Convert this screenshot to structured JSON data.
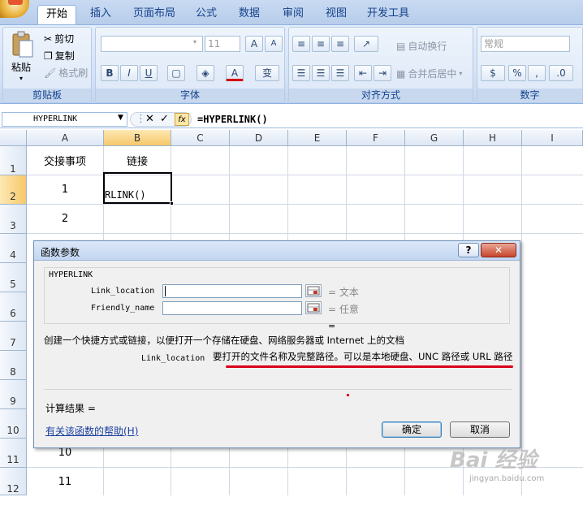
{
  "ribbon": {
    "tabs": [
      "开始",
      "插入",
      "页面布局",
      "公式",
      "数据",
      "审阅",
      "视图",
      "开发工具"
    ],
    "clipboard": {
      "paste": "粘贴",
      "cut": "剪切",
      "copy": "复制",
      "format_painter": "格式刷",
      "label": "剪贴板"
    },
    "font": {
      "size": "11",
      "bold": "B",
      "italic": "I",
      "underline": "U",
      "label": "字体",
      "grow": "A",
      "shrink": "A",
      "color": "A",
      "phonetic": "变"
    },
    "alignment": {
      "wrap": "自动换行",
      "merge": "合并后居中",
      "label": "对齐方式"
    },
    "number": {
      "format": "常规",
      "percent": "%",
      "comma": ",",
      "label": "数字",
      "currency": "$"
    }
  },
  "formula_bar": {
    "name_box": "HYPERLINK",
    "fx": "fx",
    "formula": "=HYPERLINK()"
  },
  "sheet": {
    "columns": [
      "A",
      "B",
      "C",
      "D",
      "E",
      "F",
      "G",
      "H",
      "I"
    ],
    "rows": [
      "1",
      "2",
      "3",
      "4",
      "5",
      "6",
      "7",
      "8",
      "9",
      "10",
      "11",
      "12"
    ],
    "a1": "交接事项",
    "b1": "链接",
    "a2": "1",
    "a3": "2",
    "a11": "10",
    "a12": "11",
    "b2": "RLINK()"
  },
  "dialog": {
    "title": "函数参数",
    "help_button": "?",
    "close_button": "✕",
    "function_name": "HYPERLINK",
    "arg1_label": "Link_location",
    "arg1_value": "",
    "arg1_hint": "= 文本",
    "arg2_label": "Friendly_name",
    "arg2_value": "",
    "arg2_hint": "= 任意",
    "result_eq": "=",
    "description": "创建一个快捷方式或链接，以便打开一个存储在硬盘、网络服务器或  Internet 上的文档",
    "param_name": "Link_location",
    "param_desc": "要打开的文件名称及完整路径。可以是本地硬盘、UNC 路径或 URL 路径",
    "calc_result": "计算结果 =",
    "help_link": "有关该函数的帮助(H)",
    "ok": "确定",
    "cancel": "取消"
  },
  "watermark": {
    "brand": "Bai 经验",
    "url": "jingyan.baidu.com"
  },
  "colors": {
    "underline": "#d9001b",
    "accent": "#15428b"
  }
}
